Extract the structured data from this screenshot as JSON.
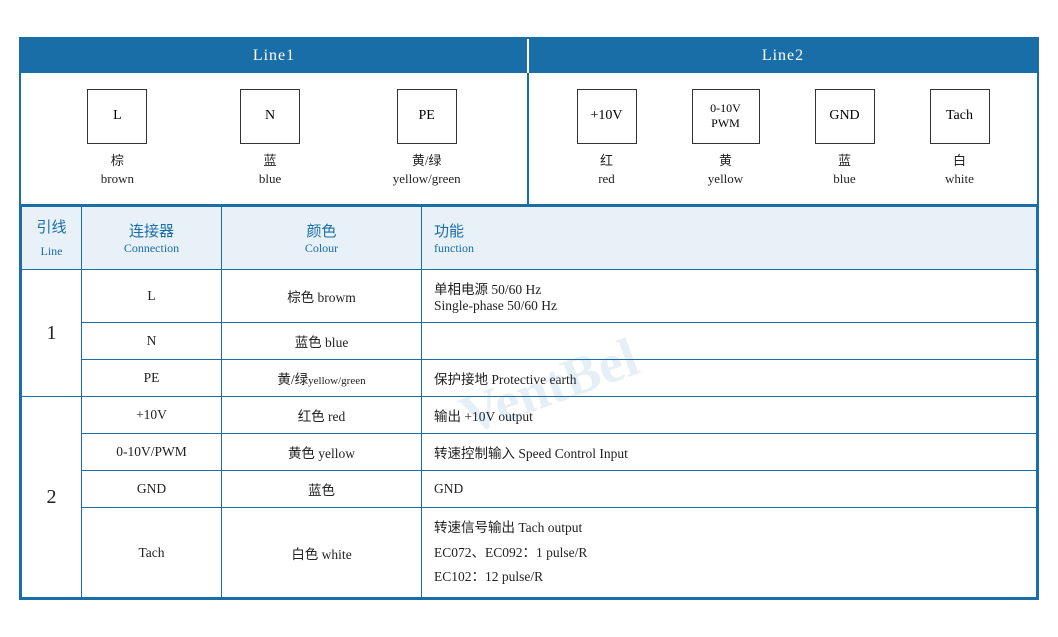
{
  "header": {
    "line1_label": "Line1",
    "line2_label": "Line2"
  },
  "line1_connectors": [
    {
      "symbol": "L",
      "chinese": "棕",
      "english": "brown"
    },
    {
      "symbol": "N",
      "chinese": "蓝",
      "english": "blue"
    },
    {
      "symbol": "PE",
      "chinese": "黄/绿",
      "english": "yellow/green"
    }
  ],
  "line2_connectors": [
    {
      "symbol": "+10V",
      "chinese": "红",
      "english": "red"
    },
    {
      "symbol": "0-10V\nPWM",
      "chinese": "黄",
      "english": "yellow"
    },
    {
      "symbol": "GND",
      "chinese": "蓝",
      "english": "blue"
    },
    {
      "symbol": "Tach",
      "chinese": "白",
      "english": "white"
    }
  ],
  "table_headers": {
    "line": {
      "main": "引线",
      "sub": "Line"
    },
    "connection": {
      "main": "连接器",
      "sub": "Connection"
    },
    "colour": {
      "main": "颜色",
      "sub": "Colour"
    },
    "function": {
      "main": "功能",
      "sub": "function"
    }
  },
  "rows": [
    {
      "line": "1",
      "rowspan": 3,
      "entries": [
        {
          "connection": "L",
          "colour": "棕色 browm",
          "function": "单相电源 50/60 Hz\nSingle-phase 50/60 Hz"
        },
        {
          "connection": "N",
          "colour": "蓝色 blue",
          "function": ""
        },
        {
          "connection": "PE",
          "colour": "黄/绿yellow/green",
          "function": "保护接地 Protective earth"
        }
      ]
    },
    {
      "line": "2",
      "rowspan": 4,
      "entries": [
        {
          "connection": "+10V",
          "colour": "红色 red",
          "function": "输出 +10V output"
        },
        {
          "connection": "0-10V/PWM",
          "colour": "黄色 yellow",
          "function": "转速控制输入 Speed Control Input"
        },
        {
          "connection": "GND",
          "colour": "蓝色",
          "function": "GND"
        },
        {
          "connection": "Tach",
          "colour": "白色 white",
          "function": "转速信号输出 Tach output\nEC072、EC092：1 pulse/R\nEC102：12 pulse/R"
        }
      ]
    }
  ]
}
